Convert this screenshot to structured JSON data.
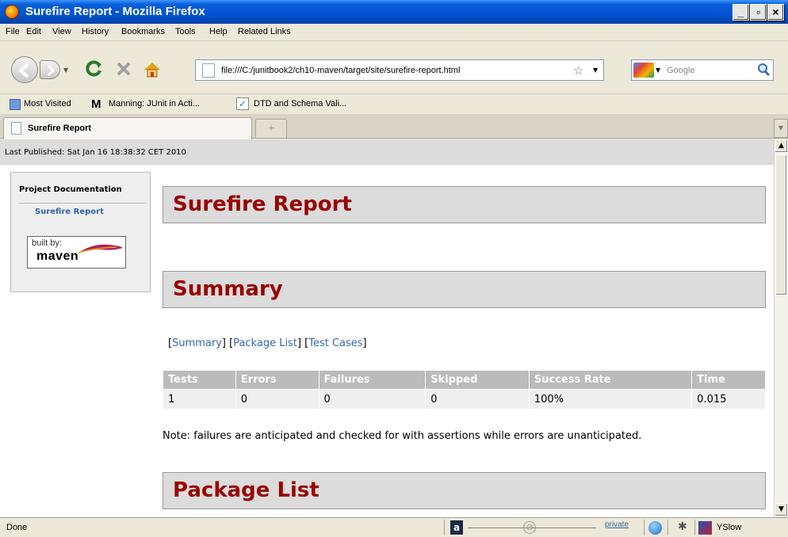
{
  "window": {
    "title": "Surefire Report - Mozilla Firefox"
  },
  "menu": [
    "File",
    "Edit",
    "View",
    "History",
    "Bookmarks",
    "Tools",
    "Help",
    "Related Links"
  ],
  "url": "file:///C:/junitbook2/ch10-maven/target/site/surefire-report.html",
  "search": {
    "placeholder": "Google"
  },
  "bookmarks": [
    "Most Visited",
    "Manning: JUnit in Acti...",
    "DTD and Schema Vali..."
  ],
  "tab": {
    "title": "Surefire Report"
  },
  "page": {
    "last_published": "Last Published: Sat Jan 16 18:38:32 CET 2010",
    "sidebar": {
      "heading": "Project Documentation",
      "link": "Surefire Report",
      "badge_top": "built by:",
      "badge_bottom": "maven"
    },
    "h1": "Surefire Report",
    "summary_heading": "Summary",
    "links": [
      "Summary",
      "Package List",
      "Test Cases"
    ],
    "table": {
      "headers": [
        "Tests",
        "Errors",
        "Failures",
        "Skipped",
        "Success Rate",
        "Time"
      ],
      "row": [
        "1",
        "0",
        "0",
        "0",
        "100%",
        "0.015"
      ]
    },
    "note": "Note: failures are anticipated and checked for with assertions while errors are unanticipated.",
    "package_heading": "Package List"
  },
  "status": {
    "text": "Done",
    "private_label": "private",
    "yslow_label": "YSlow"
  }
}
